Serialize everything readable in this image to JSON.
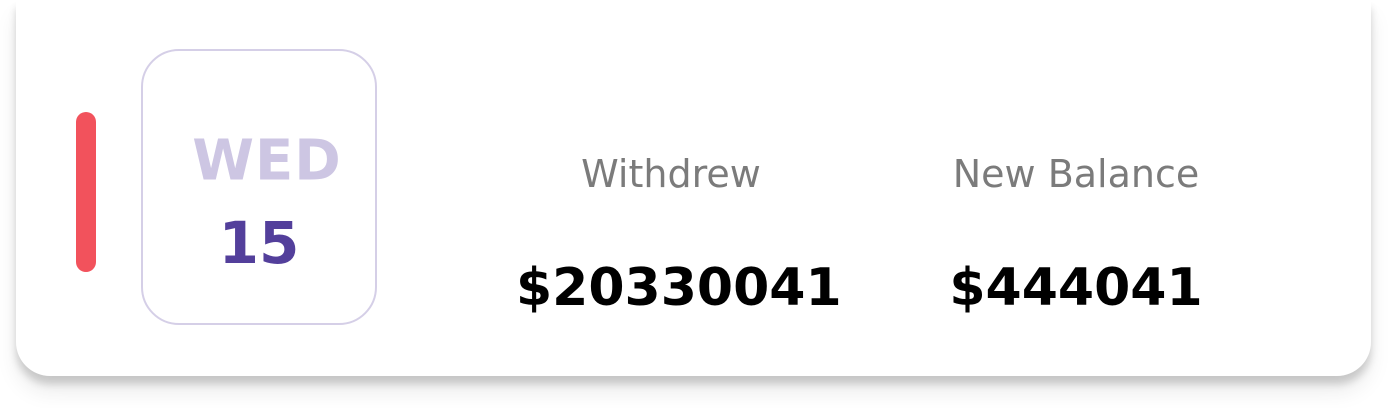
{
  "colors": {
    "accent": "#f2525c",
    "day_name": "#cdc6e3",
    "day_number": "#533f9b"
  },
  "date": {
    "day_name": "WED",
    "day_number": "15"
  },
  "withdrew": {
    "label": "Withdrew",
    "value": "$20330041"
  },
  "new_balance": {
    "label": "New Balance",
    "value": "$444041"
  }
}
